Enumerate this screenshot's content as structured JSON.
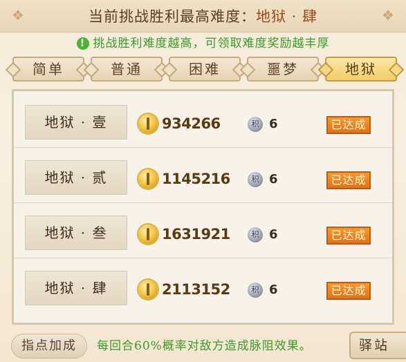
{
  "header": {
    "title_prefix": "当前挑战胜利最高难度：",
    "title_value": "地狱 · 肆"
  },
  "hint": {
    "icon": "exclamation-icon",
    "text": "挑战胜利难度越高，可领取难度奖励越丰厚"
  },
  "tabs": [
    {
      "label": "简单",
      "active": false
    },
    {
      "label": "普通",
      "active": false
    },
    {
      "label": "困难",
      "active": false
    },
    {
      "label": "噩梦",
      "active": false
    },
    {
      "label": "地狱",
      "active": true
    }
  ],
  "rows": [
    {
      "name": "地狱 · 壹",
      "score": "934266",
      "token_label": "积",
      "count": "6",
      "status": "已达成"
    },
    {
      "name": "地狱 · 贰",
      "score": "1145216",
      "token_label": "积",
      "count": "6",
      "status": "已达成"
    },
    {
      "name": "地狱 · 叁",
      "score": "1631921",
      "token_label": "积",
      "count": "6",
      "status": "已达成"
    },
    {
      "name": "地狱 · 肆",
      "score": "2113152",
      "token_label": "积",
      "count": "6",
      "status": "已达成"
    }
  ],
  "footer": {
    "tip_button": "指点加成",
    "effect_text": "每回合60%概率对敌方造成脉阻效果。",
    "station_button": "驿站"
  },
  "colors": {
    "accent_orange": "#e3721a",
    "hint_green": "#3c9a2b",
    "active_tab_gold": "#f1cc6a"
  }
}
